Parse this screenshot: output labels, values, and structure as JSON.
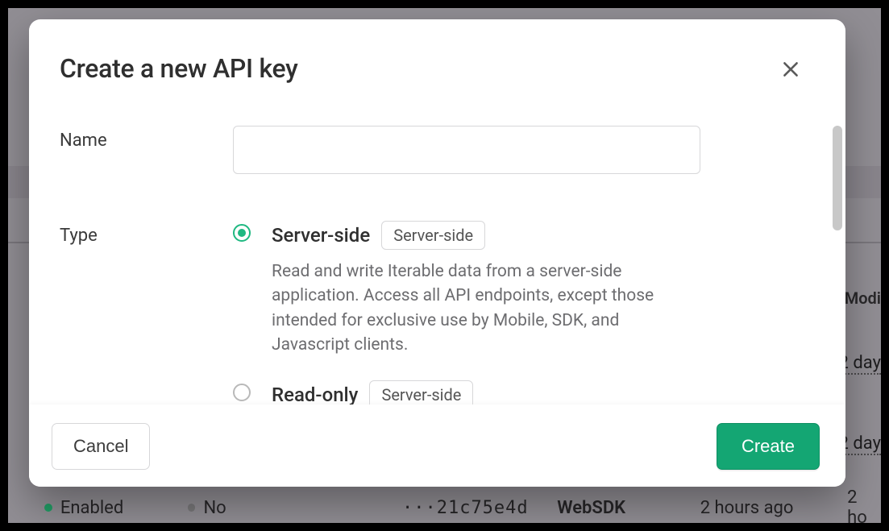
{
  "modal": {
    "title": "Create a new API key",
    "close_aria": "Close",
    "fields": {
      "name_label": "Name",
      "name_value": "",
      "name_placeholder": "",
      "type_label": "Type"
    },
    "type_options": [
      {
        "id": "server-side",
        "title": "Server-side",
        "badge": "Server-side",
        "description": "Read and write Iterable data from a server-side application. Access all API endpoints, except those intended for exclusive use by Mobile, SDK, and Javascript clients.",
        "selected": true
      },
      {
        "id": "read-only",
        "title": "Read-only",
        "badge": "Server-side",
        "description": "",
        "selected": false
      }
    ],
    "footer": {
      "cancel_label": "Cancel",
      "submit_label": "Create"
    }
  },
  "background": {
    "header_modified": "Modi",
    "rows_cut": [
      "2 day",
      "2 day"
    ],
    "visible_row": {
      "status_dot": "green",
      "status": "Enabled",
      "jwt_dot": "gray",
      "jwt": "No",
      "key_prefix": "···",
      "key": "21c75e4d",
      "name": "WebSDK",
      "created": "2 hours ago",
      "modified": "2 ho"
    }
  }
}
